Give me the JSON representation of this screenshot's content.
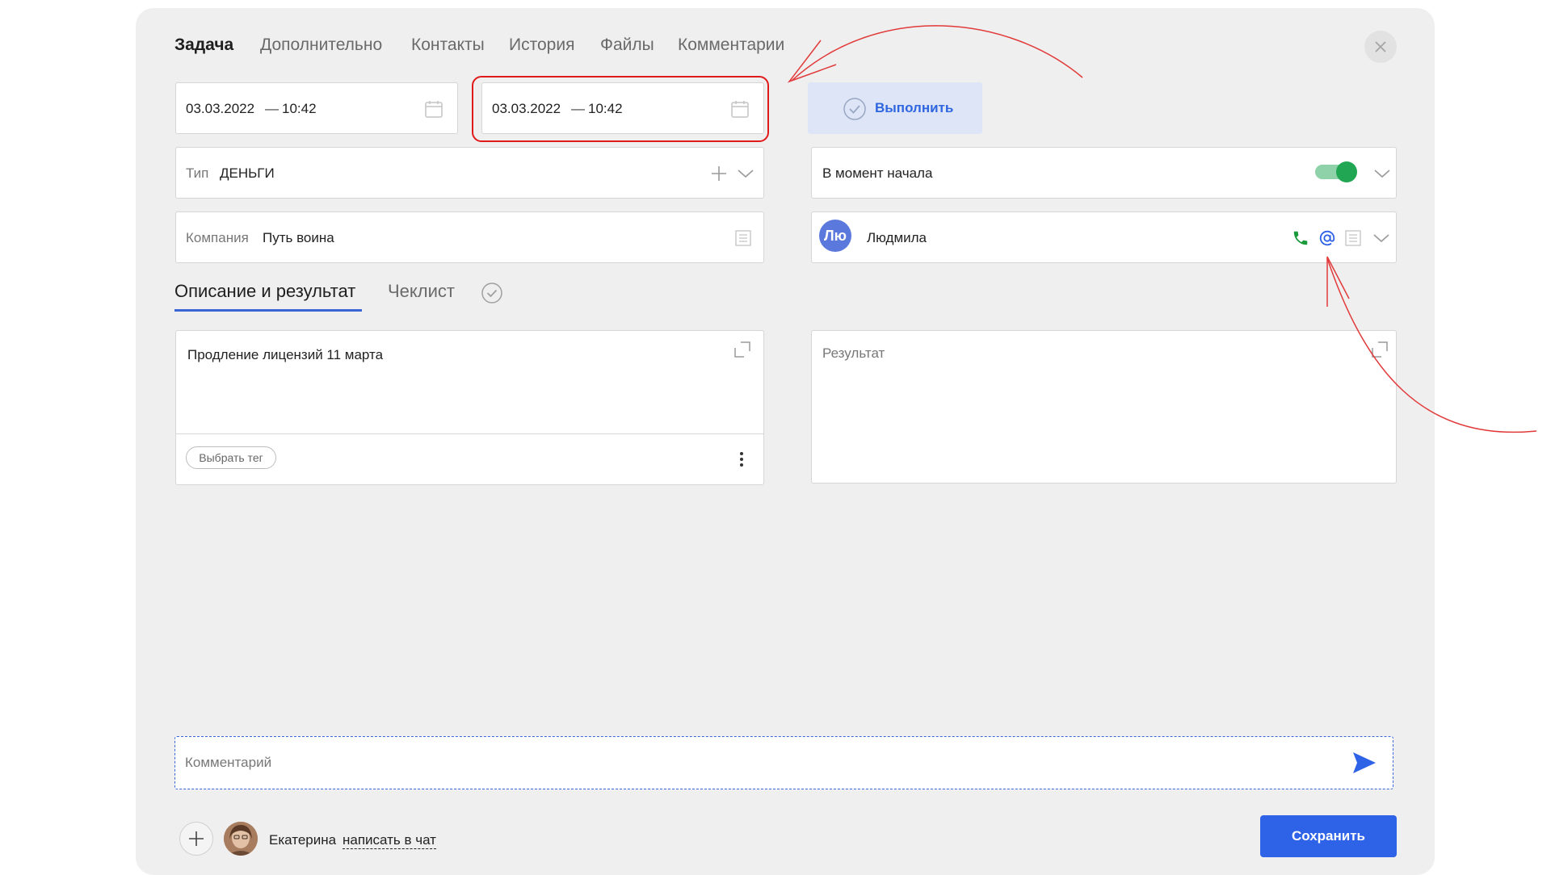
{
  "tabs": [
    "Задача",
    "Дополнительно",
    "Контакты",
    "История",
    "Файлы",
    "Комментарии"
  ],
  "date_start": {
    "date": "03.03.2022",
    "dash": "—",
    "time": "10:42"
  },
  "date_end": {
    "date": "03.03.2022",
    "dash": "—",
    "time": "10:42"
  },
  "execute_button": "Выполнить",
  "type_field": {
    "label": "Тип",
    "value": "ДЕНЬГИ"
  },
  "company_field": {
    "label": "Компания",
    "value": "Путь воина"
  },
  "reminder": {
    "label": "В момент начала",
    "enabled": true
  },
  "contact": {
    "initials": "Лю",
    "name": "Людмила"
  },
  "subtabs": {
    "description": "Описание и результат",
    "checklist": "Чеклист"
  },
  "description_text": "Продление лицензий 11 марта",
  "tag_button": "Выбрать тег",
  "result_placeholder": "Результат",
  "comment_placeholder": "Комментарий",
  "footer": {
    "user_name": "Екатерина",
    "chat_link": "написать в чат"
  },
  "save_button": "Сохранить",
  "colors": {
    "accent": "#2e63e8",
    "highlight_annotation": "#e01a1a",
    "toggle_on": "#21a653",
    "phone": "#1a9a3c"
  }
}
